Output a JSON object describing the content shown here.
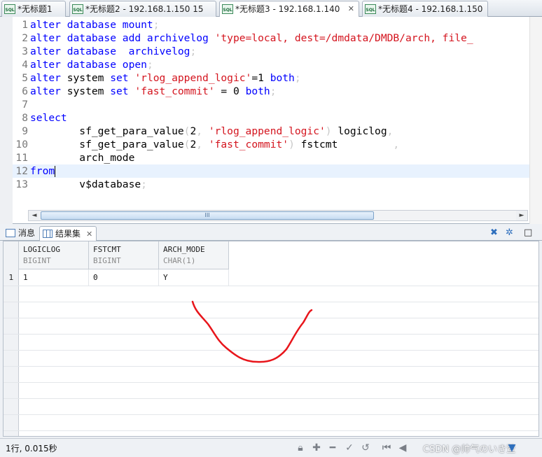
{
  "tabs": [
    {
      "label": "*无标题1",
      "active": false
    },
    {
      "label": "*无标题2 - 192.168.1.150 15",
      "active": false
    },
    {
      "label": "*无标题3 - 192.168.1.140",
      "active": true,
      "close": "✕"
    },
    {
      "label": "*无标题4 - 192.168.1.150",
      "active": false
    }
  ],
  "editor": {
    "lines": [
      {
        "num": "1",
        "segs": [
          [
            "kw",
            "alter database mount"
          ],
          [
            "punc",
            ";"
          ]
        ]
      },
      {
        "num": "2",
        "segs": [
          [
            "kw",
            "alter database add archivelog "
          ],
          [
            "str",
            "'type=local, dest=/dmdata/DMDB/arch, file_"
          ]
        ]
      },
      {
        "num": "3",
        "segs": [
          [
            "kw",
            "alter database  archivelog"
          ],
          [
            "punc",
            ";"
          ]
        ]
      },
      {
        "num": "4",
        "segs": [
          [
            "kw",
            "alter database open"
          ],
          [
            "punc",
            ";"
          ]
        ]
      },
      {
        "num": "5",
        "segs": [
          [
            "kw",
            "alter "
          ],
          [
            "txt",
            "system "
          ],
          [
            "kw",
            "set "
          ],
          [
            "str",
            "'rlog_append_logic'"
          ],
          [
            "txt",
            "=1 "
          ],
          [
            "kw",
            "both"
          ],
          [
            "punc",
            ";"
          ]
        ]
      },
      {
        "num": "6",
        "segs": [
          [
            "kw",
            "alter "
          ],
          [
            "txt",
            "system "
          ],
          [
            "kw",
            "set "
          ],
          [
            "str",
            "'fast_commit'"
          ],
          [
            "txt",
            " = 0 "
          ],
          [
            "kw",
            "both"
          ],
          [
            "punc",
            ";"
          ]
        ]
      },
      {
        "num": "7",
        "segs": []
      },
      {
        "num": "8",
        "segs": [
          [
            "kw",
            "select"
          ]
        ]
      },
      {
        "num": "9",
        "segs": [
          [
            "txt",
            "        sf_get_para_value"
          ],
          [
            "punc",
            "("
          ],
          [
            "txt",
            "2"
          ],
          [
            "punc",
            ", "
          ],
          [
            "str",
            "'rlog_append_logic'"
          ],
          [
            "punc",
            ") "
          ],
          [
            "txt",
            "logiclog"
          ],
          [
            "punc",
            ","
          ]
        ]
      },
      {
        "num": "10",
        "segs": [
          [
            "txt",
            "        sf_get_para_value"
          ],
          [
            "punc",
            "("
          ],
          [
            "txt",
            "2"
          ],
          [
            "punc",
            ", "
          ],
          [
            "str",
            "'fast_commit'"
          ],
          [
            "punc",
            ") "
          ],
          [
            "txt",
            "fstcmt"
          ],
          [
            "punc",
            "         ,"
          ]
        ]
      },
      {
        "num": "11",
        "segs": [
          [
            "txt",
            "        arch_mode"
          ]
        ]
      },
      {
        "num": "12",
        "segs": [
          [
            "kw",
            "from"
          ]
        ],
        "current": true
      },
      {
        "num": "13",
        "segs": [
          [
            "txt",
            "        v$database"
          ],
          [
            "punc",
            ";"
          ]
        ]
      }
    ],
    "hscroll_left": "◄",
    "hscroll_right": "►",
    "hscroll_grip": "III"
  },
  "panel": {
    "tabs": [
      {
        "label": "消息",
        "icon": "message-icon"
      },
      {
        "label": "结果集",
        "icon": "table-grid-icon",
        "close": "✕",
        "active": true
      }
    ]
  },
  "result": {
    "columns": [
      {
        "name": "LOGICLOG",
        "type": "BIGINT"
      },
      {
        "name": "FSTCMT",
        "type": "BIGINT"
      },
      {
        "name": "ARCH_MODE",
        "type": "CHAR(1)"
      }
    ],
    "rows": [
      {
        "num": "1",
        "values": [
          "1",
          "0",
          "Y"
        ]
      }
    ]
  },
  "status": {
    "text": "1行, 0.015秒",
    "watermark": "CSDN @帅气のいき萱"
  },
  "colors": {
    "keyword": "#0000ff",
    "string": "#d4141e",
    "annotation": "#e8151b",
    "current_line": "#e8f2fe"
  }
}
